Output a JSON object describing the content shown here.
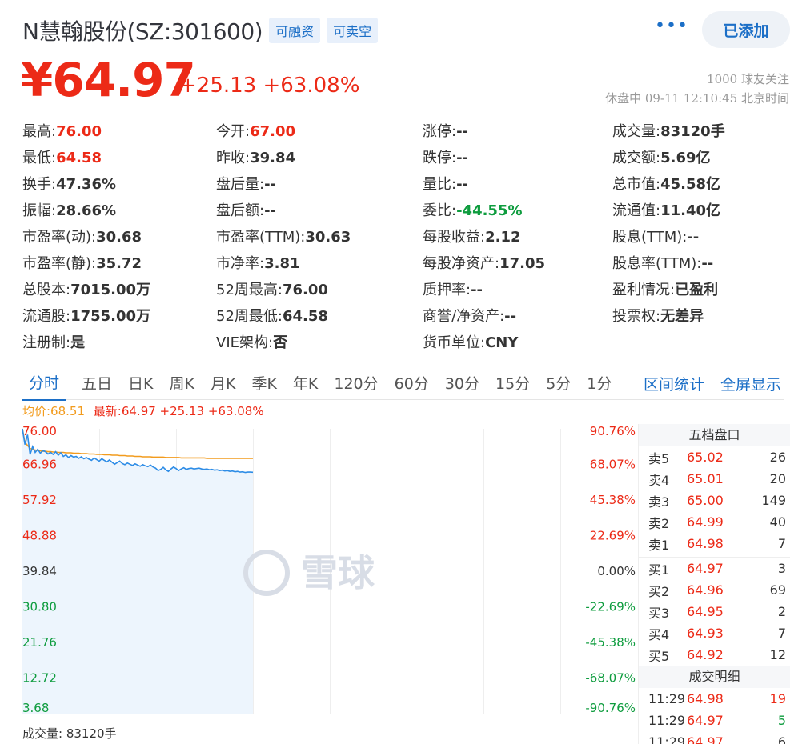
{
  "header": {
    "title": "N慧翰股份(SZ:301600)",
    "tags": [
      "可融资",
      "可卖空"
    ],
    "more_icon": "more-dots-icon",
    "add_button": "已添加"
  },
  "quote": {
    "price": "¥64.97",
    "change": "+25.13 +63.08%",
    "followers": "1000 球友关注",
    "status_time": "休盘中 09-11 12:10:45 北京时间"
  },
  "stats": [
    [
      {
        "label": "最高:",
        "value": "76.00",
        "tone": "red"
      },
      {
        "label": "今开:",
        "value": "67.00",
        "tone": "red"
      },
      {
        "label": "涨停:",
        "value": "--",
        "tone": "dark"
      },
      {
        "label": "成交量:",
        "value": "83120手",
        "tone": "dark"
      }
    ],
    [
      {
        "label": "最低:",
        "value": "64.58",
        "tone": "red"
      },
      {
        "label": "昨收:",
        "value": "39.84",
        "tone": "dark"
      },
      {
        "label": "跌停:",
        "value": "--",
        "tone": "dark"
      },
      {
        "label": "成交额:",
        "value": "5.69亿",
        "tone": "dark"
      }
    ],
    [
      {
        "label": "换手:",
        "value": "47.36%",
        "tone": "dark"
      },
      {
        "label": "盘后量:",
        "value": "--",
        "tone": "dark"
      },
      {
        "label": "量比:",
        "value": "--",
        "tone": "dark"
      },
      {
        "label": "总市值:",
        "value": "45.58亿",
        "tone": "dark"
      }
    ],
    [
      {
        "label": "振幅:",
        "value": "28.66%",
        "tone": "dark"
      },
      {
        "label": "盘后额:",
        "value": "--",
        "tone": "dark"
      },
      {
        "label": "委比:",
        "value": "-44.55%",
        "tone": "green"
      },
      {
        "label": "流通值:",
        "value": "11.40亿",
        "tone": "dark"
      }
    ],
    [
      {
        "label": "市盈率(动):",
        "value": "30.68",
        "tone": "dark"
      },
      {
        "label": "市盈率(TTM):",
        "value": "30.63",
        "tone": "dark"
      },
      {
        "label": "每股收益:",
        "value": "2.12",
        "tone": "dark"
      },
      {
        "label": "股息(TTM):",
        "value": "--",
        "tone": "dark"
      }
    ],
    [
      {
        "label": "市盈率(静):",
        "value": "35.72",
        "tone": "dark"
      },
      {
        "label": "市净率:",
        "value": "3.81",
        "tone": "dark"
      },
      {
        "label": "每股净资产:",
        "value": "17.05",
        "tone": "dark"
      },
      {
        "label": "股息率(TTM):",
        "value": "--",
        "tone": "dark"
      }
    ],
    [
      {
        "label": "总股本:",
        "value": "7015.00万",
        "tone": "dark"
      },
      {
        "label": "52周最高:",
        "value": "76.00",
        "tone": "dark"
      },
      {
        "label": "质押率:",
        "value": "--",
        "tone": "dark"
      },
      {
        "label": "盈利情况:",
        "value": "已盈利",
        "tone": "dark"
      }
    ],
    [
      {
        "label": "流通股:",
        "value": "1755.00万",
        "tone": "dark"
      },
      {
        "label": "52周最低:",
        "value": "64.58",
        "tone": "dark"
      },
      {
        "label": "商誉/净资产:",
        "value": "--",
        "tone": "dark"
      },
      {
        "label": "投票权:",
        "value": "无差异",
        "tone": "dark"
      }
    ],
    [
      {
        "label": "注册制:",
        "value": "是",
        "tone": "dark"
      },
      {
        "label": "VIE架构:",
        "value": "否",
        "tone": "dark"
      },
      {
        "label": "货币单位:",
        "value": "CNY",
        "tone": "dark"
      },
      {
        "label": "",
        "value": "",
        "tone": "dark"
      }
    ]
  ],
  "tabs": {
    "items": [
      "分时",
      "五日",
      "日K",
      "周K",
      "月K",
      "季K",
      "年K",
      "120分",
      "60分",
      "30分",
      "15分",
      "5分",
      "1分"
    ],
    "active": 0,
    "range_stats": "区间统计",
    "fullscreen": "全屏显示"
  },
  "legend": {
    "avg": "均价:68.51",
    "latest": "最新:64.97 +25.13 +63.08%"
  },
  "chart_data": {
    "type": "line",
    "y_ticks": [
      "76.00",
      "66.96",
      "57.92",
      "48.88",
      "39.84",
      "30.80",
      "21.76",
      "12.72",
      "3.68"
    ],
    "pct_ticks": [
      "90.76%",
      "68.07%",
      "45.38%",
      "22.69%",
      "0.00%",
      "-22.69%",
      "-45.38%",
      "-68.07%",
      "-90.76%"
    ],
    "ylim": [
      3.68,
      76.0
    ],
    "base": 39.84,
    "total_slots": 240,
    "series": [
      {
        "values": [
          76.0,
          72.0,
          74.5,
          69.5,
          71.5,
          70.0,
          70.8,
          69.8,
          70.5,
          70.2,
          69.6,
          70.0,
          69.5,
          70.2,
          69.3,
          69.9,
          69.0,
          69.4,
          68.7,
          69.2,
          68.8,
          69.0,
          68.5,
          68.9,
          68.4,
          68.7,
          68.3,
          68.0,
          68.6,
          68.2,
          67.8,
          68.4,
          68.0,
          67.6,
          68.1,
          67.5,
          67.0,
          67.4,
          67.8,
          67.2,
          66.9,
          67.3,
          67.0,
          66.7,
          67.1,
          66.8,
          66.5,
          66.9,
          66.6,
          66.4,
          66.8,
          66.3,
          66.0,
          65.4,
          65.7,
          66.2,
          65.6,
          65.2,
          65.8,
          66.3,
          65.9,
          65.4,
          65.8,
          66.1,
          65.7,
          65.9,
          66.0,
          65.8,
          65.9,
          66.0,
          65.8,
          65.7,
          65.8,
          65.6,
          65.7,
          65.5,
          65.6,
          65.4,
          65.5,
          65.3,
          65.4,
          65.2,
          65.3,
          65.1,
          65.2,
          65.0,
          65.1,
          64.9,
          65.0,
          65.0,
          64.97
        ]
      },
      {
        "values": [
          76.0,
          72.5,
          71.8,
          71.0,
          70.8,
          70.6,
          70.5,
          70.4,
          70.3,
          70.3,
          70.2,
          70.2,
          70.1,
          70.1,
          70.0,
          70.0,
          70.0,
          69.9,
          69.9,
          69.9,
          69.8,
          69.8,
          69.8,
          69.7,
          69.7,
          69.7,
          69.6,
          69.6,
          69.6,
          69.5,
          69.5,
          69.5,
          69.4,
          69.4,
          69.4,
          69.3,
          69.3,
          69.3,
          69.2,
          69.2,
          69.2,
          69.1,
          69.1,
          69.1,
          69.0,
          69.0,
          69.0,
          68.9,
          68.9,
          68.9,
          68.9,
          68.8,
          68.8,
          68.8,
          68.8,
          68.8,
          68.7,
          68.7,
          68.7,
          68.7,
          68.7,
          68.7,
          68.6,
          68.6,
          68.6,
          68.6,
          68.6,
          68.6,
          68.6,
          68.6,
          68.6,
          68.6,
          68.5,
          68.5,
          68.5,
          68.5,
          68.5,
          68.5,
          68.5,
          68.5,
          68.5,
          68.5,
          68.5,
          68.5,
          68.5,
          68.5,
          68.5,
          68.5,
          68.5,
          68.5,
          68.51
        ]
      }
    ]
  },
  "watermark": "雪球",
  "volume_label": "成交量: 83120手",
  "order_book": {
    "title": "五档盘口",
    "asks": [
      {
        "name": "卖5",
        "price": "65.02",
        "vol": "26"
      },
      {
        "name": "卖4",
        "price": "65.01",
        "vol": "20"
      },
      {
        "name": "卖3",
        "price": "65.00",
        "vol": "149"
      },
      {
        "name": "卖2",
        "price": "64.99",
        "vol": "40"
      },
      {
        "name": "卖1",
        "price": "64.98",
        "vol": "7"
      }
    ],
    "bids": [
      {
        "name": "买1",
        "price": "64.97",
        "vol": "3"
      },
      {
        "name": "买2",
        "price": "64.96",
        "vol": "69"
      },
      {
        "name": "买3",
        "price": "64.95",
        "vol": "2"
      },
      {
        "name": "买4",
        "price": "64.93",
        "vol": "7"
      },
      {
        "name": "买5",
        "price": "64.92",
        "vol": "12"
      }
    ]
  },
  "trades": {
    "title": "成交明细",
    "rows": [
      {
        "time": "11:29",
        "price": "64.98",
        "vol": "19",
        "tone": "red"
      },
      {
        "time": "11:29",
        "price": "64.97",
        "vol": "5",
        "tone": "green"
      },
      {
        "time": "11:29",
        "price": "64.97",
        "vol": "6",
        "tone": "dark"
      }
    ]
  },
  "colors": {
    "up": "#ec2a17",
    "down": "#0e9c3e",
    "accent": "#1c6fc7",
    "price_line": "#2d8ce6",
    "avg_line": "#f29b1d",
    "area_fill": "#edf5fd"
  }
}
